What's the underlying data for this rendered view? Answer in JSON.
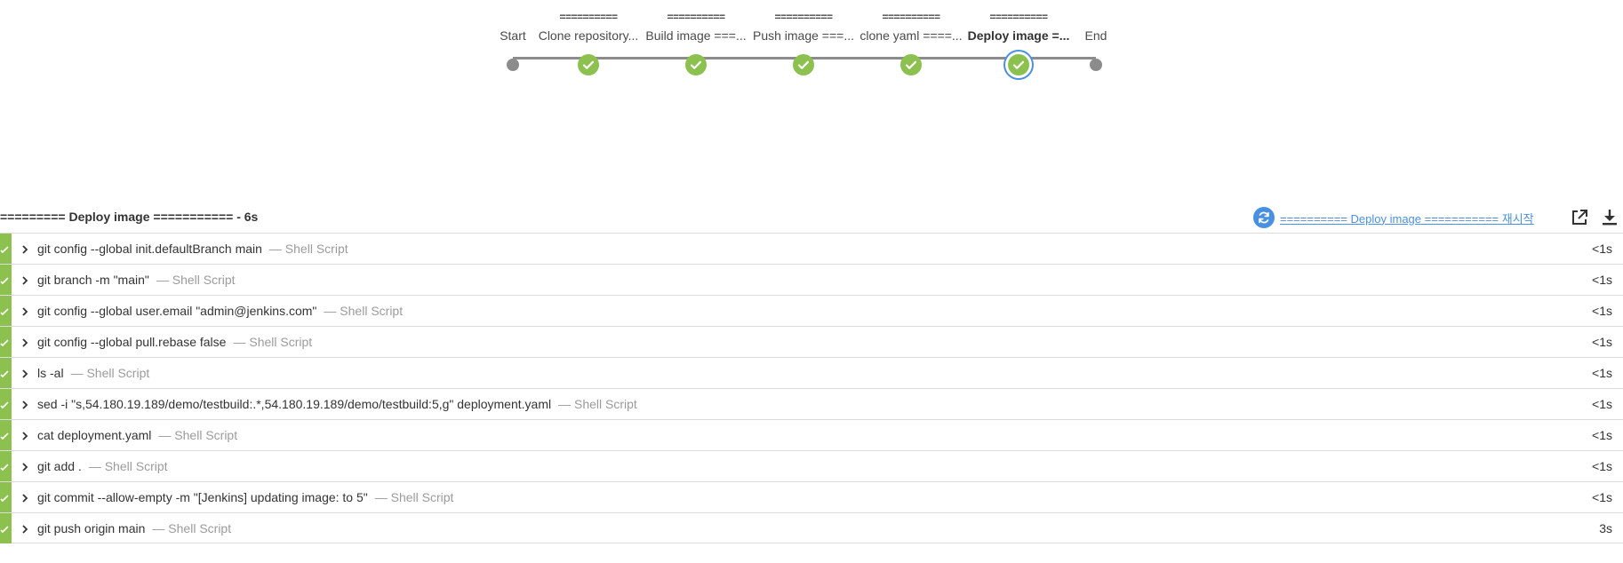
{
  "pipeline": {
    "stages": [
      {
        "top": "",
        "name": "Start",
        "status": "node"
      },
      {
        "top": "==========",
        "name": "Clone repository...",
        "status": "success"
      },
      {
        "top": "==========",
        "name": "Build image ===...",
        "status": "success"
      },
      {
        "top": "==========",
        "name": "Push image ===...",
        "status": "success"
      },
      {
        "top": "==========",
        "name": "clone yaml ====...",
        "status": "success"
      },
      {
        "top": "==========",
        "name": "Deploy image =...",
        "status": "success",
        "selected": true
      },
      {
        "top": "",
        "name": "End",
        "status": "node"
      }
    ]
  },
  "log_header": {
    "title": "========= Deploy image =========== - 6s",
    "restart_label": "========== Deploy image =========== 재시작",
    "open_icon": "external-link-icon",
    "download_icon": "download-icon"
  },
  "steps": [
    {
      "cmd": "git config --global init.defaultBranch main",
      "type": "— Shell Script",
      "time": "<1s"
    },
    {
      "cmd": "git branch -m \"main\"",
      "type": "— Shell Script",
      "time": "<1s"
    },
    {
      "cmd": "git config --global user.email \"admin@jenkins.com\"",
      "type": "— Shell Script",
      "time": "<1s"
    },
    {
      "cmd": "git config --global pull.rebase false",
      "type": "— Shell Script",
      "time": "<1s"
    },
    {
      "cmd": "ls -al",
      "type": "— Shell Script",
      "time": "<1s"
    },
    {
      "cmd": "sed -i \"s,54.180.19.189/demo/testbuild:.*,54.180.19.189/demo/testbuild:5,g\" deployment.yaml",
      "type": "— Shell Script",
      "time": "<1s"
    },
    {
      "cmd": "cat deployment.yaml",
      "type": "— Shell Script",
      "time": "<1s"
    },
    {
      "cmd": "git add .",
      "type": "— Shell Script",
      "time": "<1s"
    },
    {
      "cmd": "git commit --allow-empty -m \"[Jenkins] updating image: to 5\"",
      "type": "— Shell Script",
      "time": "<1s"
    },
    {
      "cmd": "git push origin main",
      "type": "— Shell Script",
      "time": "3s"
    }
  ],
  "colors": {
    "success": "#8cc04f",
    "accent": "#4a90e2",
    "track": "#8c8c8c"
  }
}
